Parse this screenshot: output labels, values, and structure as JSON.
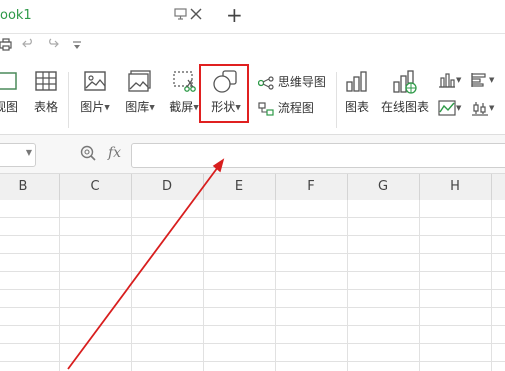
{
  "titlebar": {
    "tab_title": "ook1",
    "new_tab_symbol": "+"
  },
  "ribbon": {
    "partial_view_label": "视图",
    "table_label": "表格",
    "picture_label": "图片",
    "gallery_label": "图库",
    "screenshot_label": "截屏",
    "shapes_label": "形状",
    "mindmap_label": "思维导图",
    "flowchart_label": "流程图",
    "chart_label": "图表",
    "online_chart_label": "在线图表"
  },
  "formula": {
    "fx_label": "fx"
  },
  "columns": [
    "B",
    "C",
    "D",
    "E",
    "F",
    "G",
    "H"
  ],
  "colors": {
    "accent_green": "#2e9a48",
    "highlight_red": "#e02020",
    "arrow_red": "#d81e1e"
  }
}
